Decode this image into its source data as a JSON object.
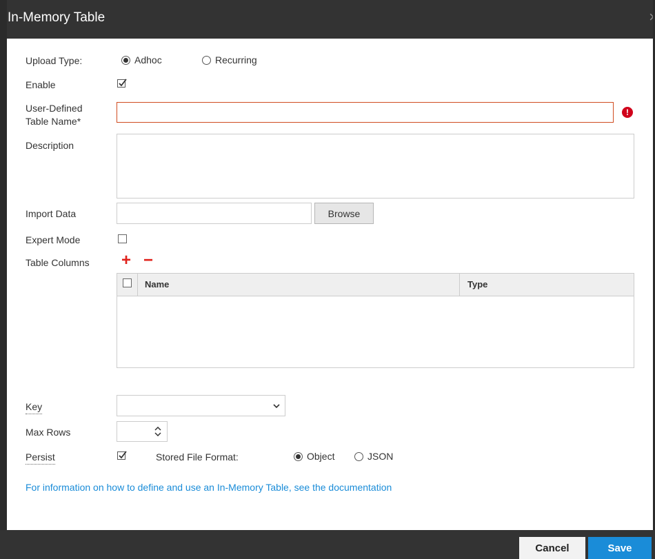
{
  "dialog": {
    "title": "In-Memory Table",
    "close_glyph": "×"
  },
  "upload_type": {
    "label": "Upload Type:",
    "options": [
      {
        "label": "Adhoc",
        "selected": true
      },
      {
        "label": "Recurring",
        "selected": false
      }
    ]
  },
  "enable": {
    "label": "Enable",
    "checked": true
  },
  "table_name": {
    "label_line1": "User-Defined",
    "label_line2": "Table Name*",
    "value": "",
    "error_glyph": "!"
  },
  "description": {
    "label": "Description",
    "value": ""
  },
  "import_data": {
    "label": "Import Data",
    "value": "",
    "browse_label": "Browse"
  },
  "expert_mode": {
    "label": "Expert Mode",
    "checked": false
  },
  "table_columns": {
    "label": "Table Columns",
    "add_glyph": "+",
    "remove_glyph": "−",
    "headers": [
      "Name",
      "Type"
    ],
    "rows": []
  },
  "key": {
    "label": "Key",
    "selected": ""
  },
  "max_rows": {
    "label": "Max Rows",
    "value": ""
  },
  "persist": {
    "label": "Persist",
    "checked": true,
    "file_format_label": "Stored File Format:",
    "options": [
      {
        "label": "Object",
        "selected": true
      },
      {
        "label": "JSON",
        "selected": false
      }
    ]
  },
  "help_link": "For information on how to define and use an In-Memory Table, see the documentation",
  "footer": {
    "cancel_label": "Cancel",
    "save_label": "Save"
  },
  "colors": {
    "accent": "#1a8cd8",
    "error": "#d0021b",
    "titlebar": "#333333"
  }
}
